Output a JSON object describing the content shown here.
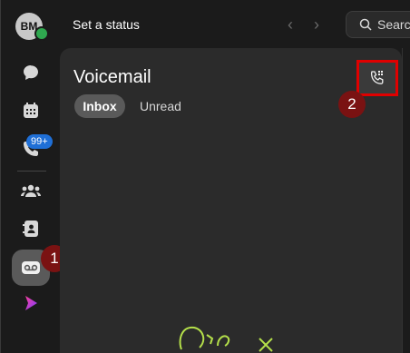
{
  "sidebar": {
    "avatar_initials": "BM",
    "badge": "99+",
    "icons": [
      "chat-icon",
      "calendar-icon",
      "calls-icon",
      "teams-icon",
      "contacts-icon",
      "voicemail-icon",
      "app-icon"
    ]
  },
  "header": {
    "status": "Set a status",
    "search_placeholder": "Searc"
  },
  "voicemail": {
    "title": "Voicemail",
    "tabs": [
      {
        "label": "Inbox",
        "active": true
      },
      {
        "label": "Unread",
        "active": false
      }
    ]
  },
  "markers": {
    "one": "1",
    "two": "2"
  },
  "colors": {
    "accent": "#1f6fd6",
    "callout": "#e00000",
    "marker": "#7a1212",
    "presence": "#2fa84f"
  }
}
